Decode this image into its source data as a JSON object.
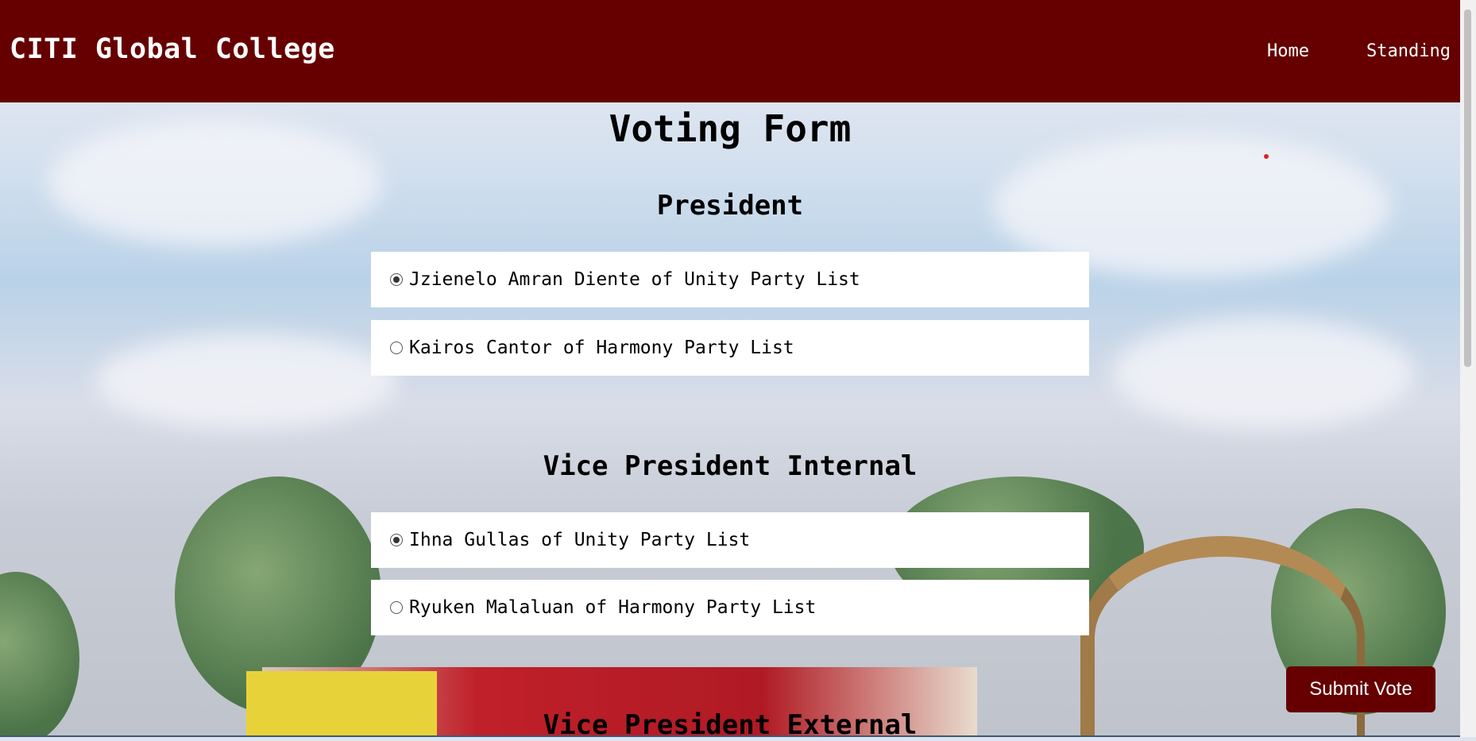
{
  "navbar": {
    "brand": "CITI Global College",
    "links": [
      {
        "label": "Home"
      },
      {
        "label": "Standing"
      }
    ]
  },
  "form": {
    "title": "Voting Form",
    "sections": [
      {
        "title": "President",
        "options": [
          {
            "label": "Jzienelo Amran Diente of Unity Party List",
            "selected": true
          },
          {
            "label": "Kairos Cantor of Harmony Party List",
            "selected": false
          }
        ]
      },
      {
        "title": "Vice President Internal",
        "options": [
          {
            "label": "Ihna Gullas of Unity Party List",
            "selected": true
          },
          {
            "label": "Ryuken Malaluan of Harmony Party List",
            "selected": false
          }
        ]
      },
      {
        "title": "Vice President External",
        "options": []
      }
    ],
    "submit_label": "Submit Vote"
  },
  "colors": {
    "primary": "#660000",
    "card": "#ffffff"
  }
}
